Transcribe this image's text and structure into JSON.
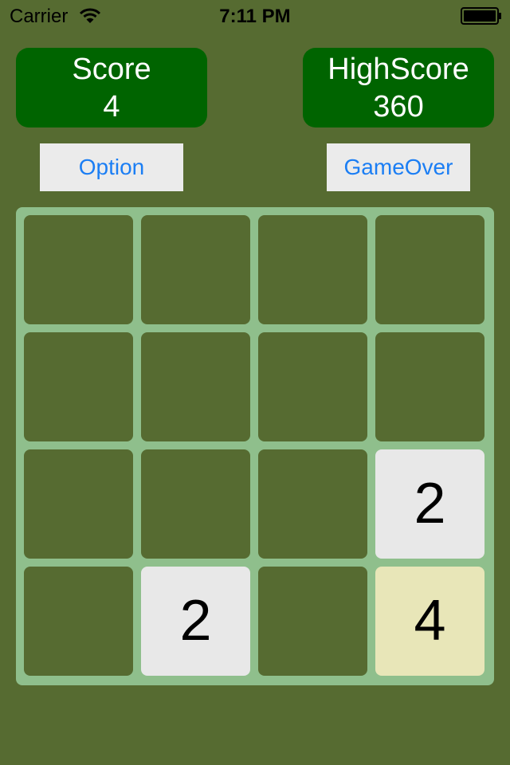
{
  "status_bar": {
    "carrier": "Carrier",
    "time": "7:11 PM"
  },
  "score": {
    "label": "Score",
    "value": "4"
  },
  "highscore": {
    "label": "HighScore",
    "value": "360"
  },
  "buttons": {
    "option": "Option",
    "gameover": "GameOver"
  },
  "board": {
    "size": 4,
    "cells": [
      [
        "",
        "",
        "",
        ""
      ],
      [
        "",
        "",
        "",
        ""
      ],
      [
        "",
        "",
        "",
        "2"
      ],
      [
        "",
        "2",
        "",
        "4"
      ]
    ]
  },
  "colors": {
    "background": "#566b31",
    "score_panel": "#006400",
    "board": "#8fbf8c",
    "empty_tile": "#566b31",
    "tile_2": "#e8e8e8",
    "tile_4": "#e8e6b8",
    "button_text": "#1b7ef4"
  }
}
